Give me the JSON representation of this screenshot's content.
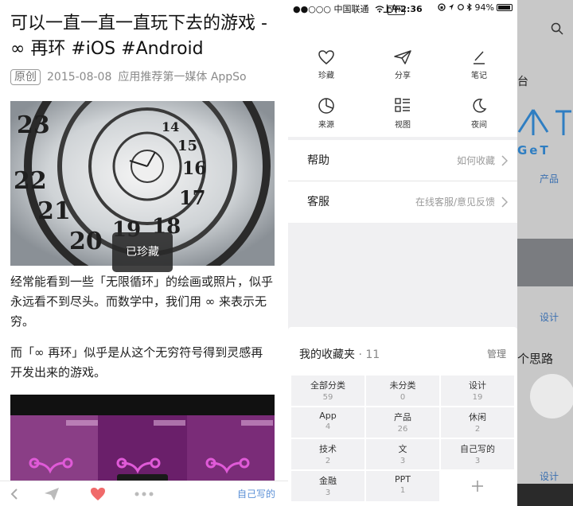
{
  "article": {
    "title": "可以一直一直一直玩下去的游戏 - ∞ 再环 #iOS #Android",
    "tag": "原创",
    "date": "2015-08-08",
    "source": "应用推荐第一媒体 AppSo",
    "toast": "已珍藏",
    "paragraph1": "经常能看到一些「无限循环」的绘画或照片，似乎永远看不到尽头。而数学中，我们用 ∞ 来表示无穷。",
    "paragraph2": "而「∞ 再环」似乎是从这个无穷符号得到灵感再开发出来的游戏。",
    "bottom_label": "自己写的",
    "clock_numerals": [
      "23",
      "22",
      "21",
      "20",
      "19",
      "18",
      "17",
      "16",
      "15",
      "14"
    ]
  },
  "status_bar": {
    "carrier": "●●○○○ 中国联通",
    "vpn": "VPN",
    "time": "上午2:36",
    "battery": "94%"
  },
  "menu": {
    "actions": [
      {
        "label": "珍藏",
        "icon": "heart-icon"
      },
      {
        "label": "分享",
        "icon": "paper-plane-icon"
      },
      {
        "label": "笔记",
        "icon": "pen-icon"
      },
      {
        "label": "来源",
        "icon": "pie-chart-icon"
      },
      {
        "label": "视图",
        "icon": "list-view-icon"
      },
      {
        "label": "夜间",
        "icon": "moon-icon"
      }
    ],
    "rows": [
      {
        "label": "帮助",
        "value": "如何收藏"
      },
      {
        "label": "客服",
        "value": "在线客服/意见反馈"
      }
    ],
    "favorites": {
      "title": "我的收藏夹",
      "count": "11",
      "manage": "管理",
      "folders": [
        {
          "name": "全部分类",
          "count": "59"
        },
        {
          "name": "未分类",
          "count": "0"
        },
        {
          "name": "设计",
          "count": "19"
        },
        {
          "name": "App",
          "count": "4"
        },
        {
          "name": "产品",
          "count": "26"
        },
        {
          "name": "休闲",
          "count": "2"
        },
        {
          "name": "技术",
          "count": "2"
        },
        {
          "name": "文",
          "count": "3"
        },
        {
          "name": "自己写的",
          "count": "3"
        },
        {
          "name": "金融",
          "count": "3"
        },
        {
          "name": "PPT",
          "count": "1"
        }
      ]
    }
  },
  "background": {
    "fragment1": "台",
    "fragment2": "产品",
    "fragment3": "设计",
    "fragment4": "个思路",
    "fragment5": "设计",
    "fragment6": "GeT"
  }
}
